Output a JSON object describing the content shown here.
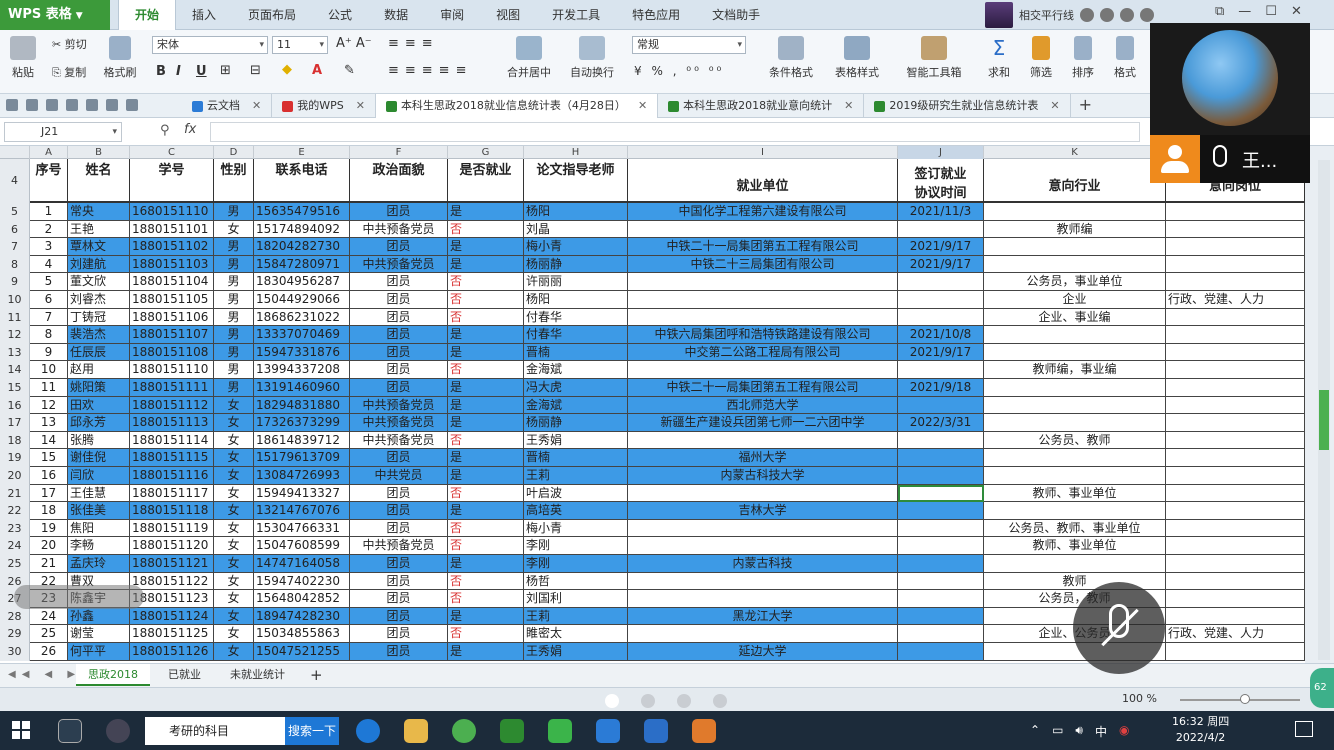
{
  "app": {
    "logo": "WPS 表格",
    "menu": [
      "开始",
      "插入",
      "页面布局",
      "公式",
      "数据",
      "审阅",
      "视图",
      "开发工具",
      "特色应用",
      "文档助手"
    ],
    "user": "相交平行线"
  },
  "ribbon": {
    "paste": "粘贴",
    "cut": "剪切",
    "copy": "复制",
    "format_painter": "格式刷",
    "font_name": "宋体",
    "font_size": "11",
    "merge_center": "合并居中",
    "wrap_text": "自动换行",
    "number_format": "常规",
    "conditional_format": "条件格式",
    "table_style": "表格样式",
    "smart_toolbox": "智能工具箱",
    "sum": "求和",
    "filter": "筛选",
    "sort": "排序",
    "format": "格式"
  },
  "doc_tabs": [
    {
      "label": "云文档",
      "color": "#2b7bd6"
    },
    {
      "label": "我的WPS",
      "color": "#d83030"
    },
    {
      "label": "本科生思政2018就业信息统计表（4月28日）",
      "color": "#2d8a30"
    },
    {
      "label": "本科生思政2018就业意向统计",
      "color": "#2d8a30"
    },
    {
      "label": "2019级研究生就业信息统计表",
      "color": "#2d8a30"
    }
  ],
  "formula_bar": {
    "cell_ref": "J21",
    "fx": "fx"
  },
  "columns": [
    "A",
    "B",
    "C",
    "D",
    "E",
    "F",
    "G",
    "H",
    "I",
    "J",
    "K",
    "L"
  ],
  "headers": {
    "a": "序号",
    "b": "姓名",
    "c": "学号",
    "d": "性别",
    "e": "联系电话",
    "f": "政治面貌",
    "g": "是否就业",
    "h": "论文指导老师",
    "i": "就业单位",
    "j1": "签订就业",
    "j2": "协议时间",
    "k": "意向行业",
    "l": "意向岗位"
  },
  "header_row_number": "4",
  "rows": [
    {
      "n": "5",
      "blue": true,
      "a": "1",
      "b": "常央",
      "c": "1680151110",
      "d": "男",
      "e": "15635479516",
      "f": "团员",
      "g": "是",
      "h": "杨阳",
      "i": "中国化学工程第六建设有限公司",
      "j": "2021/11/3",
      "k": "",
      "l": ""
    },
    {
      "n": "6",
      "blue": false,
      "a": "2",
      "b": "王艳",
      "c": "1880151101",
      "d": "女",
      "e": "15174894092",
      "f": "中共预备党员",
      "g": "否",
      "h": "刘晶",
      "i": "",
      "j": "",
      "k": "教师编",
      "l": ""
    },
    {
      "n": "7",
      "blue": true,
      "a": "3",
      "b": "覃林文",
      "c": "1880151102",
      "d": "男",
      "e": "18204282730",
      "f": "团员",
      "g": "是",
      "h": "梅小青",
      "i": "中铁二十一局集团第五工程有限公司",
      "j": "2021/9/17",
      "k": "",
      "l": ""
    },
    {
      "n": "8",
      "blue": true,
      "a": "4",
      "b": "刘建航",
      "c": "1880151103",
      "d": "男",
      "e": "15847280971",
      "f": "中共预备党员",
      "g": "是",
      "h": "杨丽静",
      "i": "中铁二十三局集团有限公司",
      "j": "2021/9/17",
      "k": "",
      "l": ""
    },
    {
      "n": "9",
      "blue": false,
      "a": "5",
      "b": "董文欣",
      "c": "1880151104",
      "d": "男",
      "e": "18304956287",
      "f": "团员",
      "g": "否",
      "h": "许丽丽",
      "i": "",
      "j": "",
      "k": "公务员，事业单位",
      "l": ""
    },
    {
      "n": "10",
      "blue": false,
      "a": "6",
      "b": "刘睿杰",
      "c": "1880151105",
      "d": "男",
      "e": "15044929066",
      "f": "团员",
      "g": "否",
      "h": "杨阳",
      "i": "",
      "j": "",
      "k": "企业",
      "l": "行政、党建、人力"
    },
    {
      "n": "11",
      "blue": false,
      "a": "7",
      "b": "丁铸冠",
      "c": "1880151106",
      "d": "男",
      "e": "18686231022",
      "f": "团员",
      "g": "否",
      "h": "付春华",
      "i": "",
      "j": "",
      "k": "企业、事业编",
      "l": ""
    },
    {
      "n": "12",
      "blue": true,
      "a": "8",
      "b": "裴浩杰",
      "c": "1880151107",
      "d": "男",
      "e": "13337070469",
      "f": "团员",
      "g": "是",
      "h": "付春华",
      "i": "中铁六局集团呼和浩特铁路建设有限公司",
      "j": "2021/10/8",
      "k": "",
      "l": ""
    },
    {
      "n": "13",
      "blue": true,
      "a": "9",
      "b": "任辰辰",
      "c": "1880151108",
      "d": "男",
      "e": "15947331876",
      "f": "团员",
      "g": "是",
      "h": "晋楠",
      "i": "中交第二公路工程局有限公司",
      "j": "2021/9/17",
      "k": "",
      "l": ""
    },
    {
      "n": "14",
      "blue": false,
      "a": "10",
      "b": "赵用",
      "c": "1880151110",
      "d": "男",
      "e": "13994337208",
      "f": "团员",
      "g": "否",
      "h": "金海斌",
      "i": "",
      "j": "",
      "k": "教师编，事业编",
      "l": ""
    },
    {
      "n": "15",
      "blue": true,
      "a": "11",
      "b": "姚阳策",
      "c": "1880151111",
      "d": "男",
      "e": "13191460960",
      "f": "团员",
      "g": "是",
      "h": "冯大虎",
      "i": "中铁二十一局集团第五工程有限公司",
      "j": "2021/9/18",
      "k": "",
      "l": ""
    },
    {
      "n": "16",
      "blue": true,
      "a": "12",
      "b": "田欢",
      "c": "1880151112",
      "d": "女",
      "e": "18294831880",
      "f": "中共预备党员",
      "g": "是",
      "h": "金海斌",
      "i": "西北师范大学",
      "j": "",
      "k": "",
      "l": ""
    },
    {
      "n": "17",
      "blue": true,
      "a": "13",
      "b": "邱永芳",
      "c": "1880151113",
      "d": "女",
      "e": "17326373299",
      "f": "中共预备党员",
      "g": "是",
      "h": "杨丽静",
      "i": "新疆生产建设兵团第七师一二六团中学",
      "j": "2022/3/31",
      "k": "",
      "l": ""
    },
    {
      "n": "18",
      "blue": false,
      "a": "14",
      "b": "张腾",
      "c": "1880151114",
      "d": "女",
      "e": "18614839712",
      "f": "中共预备党员",
      "g": "否",
      "h": "王秀娟",
      "i": "",
      "j": "",
      "k": "公务员、教师",
      "l": ""
    },
    {
      "n": "19",
      "blue": true,
      "a": "15",
      "b": "谢佳倪",
      "c": "1880151115",
      "d": "女",
      "e": "15179613709",
      "f": "团员",
      "g": "是",
      "h": "晋楠",
      "i": "福州大学",
      "j": "",
      "k": "",
      "l": ""
    },
    {
      "n": "20",
      "blue": true,
      "a": "16",
      "b": "闫欣",
      "c": "1880151116",
      "d": "女",
      "e": "13084726993",
      "f": "中共党员",
      "g": "是",
      "h": "王莉",
      "i": "内蒙古科技大学",
      "j": "",
      "k": "",
      "l": ""
    },
    {
      "n": "21",
      "blue": false,
      "a": "17",
      "b": "王佳慧",
      "c": "1880151117",
      "d": "女",
      "e": "15949413327",
      "f": "团员",
      "g": "否",
      "h": "叶启波",
      "i": "",
      "j": "",
      "k": "教师、事业单位",
      "l": "",
      "selected": true
    },
    {
      "n": "22",
      "blue": true,
      "a": "18",
      "b": "张佳美",
      "c": "1880151118",
      "d": "女",
      "e": "13214767076",
      "f": "团员",
      "g": "是",
      "h": "高培英",
      "i": "吉林大学",
      "j": "",
      "k": "",
      "l": ""
    },
    {
      "n": "23",
      "blue": false,
      "a": "19",
      "b": "焦阳",
      "c": "1880151119",
      "d": "女",
      "e": "15304766331",
      "f": "团员",
      "g": "否",
      "h": "梅小青",
      "i": "",
      "j": "",
      "k": "公务员、教师、事业单位",
      "l": ""
    },
    {
      "n": "24",
      "blue": false,
      "a": "20",
      "b": "李畅",
      "c": "1880151120",
      "d": "女",
      "e": "15047608599",
      "f": "中共预备党员",
      "g": "否",
      "h": "李刚",
      "i": "",
      "j": "",
      "k": "教师、事业单位",
      "l": ""
    },
    {
      "n": "25",
      "blue": true,
      "a": "21",
      "b": "孟庆玲",
      "c": "1880151121",
      "d": "女",
      "e": "14747164058",
      "f": "团员",
      "g": "是",
      "h": "李刚",
      "i": "内蒙古科技",
      "j": "",
      "k": "",
      "l": ""
    },
    {
      "n": "26",
      "blue": false,
      "a": "22",
      "b": "曹双",
      "c": "1880151122",
      "d": "女",
      "e": "15947402230",
      "f": "团员",
      "g": "否",
      "h": "杨哲",
      "i": "",
      "j": "",
      "k": "教师",
      "l": ""
    },
    {
      "n": "27",
      "blue": false,
      "a": "23",
      "b": "陈鑫宇",
      "c": "1880151123",
      "d": "女",
      "e": "15648042852",
      "f": "团员",
      "g": "否",
      "h": "刘国利",
      "i": "",
      "j": "",
      "k": "公务员，教师",
      "l": ""
    },
    {
      "n": "28",
      "blue": true,
      "a": "24",
      "b": "孙鑫",
      "c": "1880151124",
      "d": "女",
      "e": "18947428230",
      "f": "团员",
      "g": "是",
      "h": "王莉",
      "i": "黑龙江大学",
      "j": "",
      "k": "",
      "l": ""
    },
    {
      "n": "29",
      "blue": false,
      "a": "25",
      "b": "谢莹",
      "c": "1880151125",
      "d": "女",
      "e": "15034855863",
      "f": "团员",
      "g": "否",
      "h": "睢密太",
      "i": "",
      "j": "",
      "k": "企业、公务员",
      "l": "行政、党建、人力"
    },
    {
      "n": "30",
      "blue": true,
      "a": "26",
      "b": "何平平",
      "c": "1880151126",
      "d": "女",
      "e": "15047521255",
      "f": "团员",
      "g": "是",
      "h": "王秀娟",
      "i": "延边大学",
      "j": "",
      "k": "",
      "l": ""
    }
  ],
  "sheets": [
    "思政2018",
    "已就业",
    "未就业统计"
  ],
  "status": {
    "zoom": "100 %"
  },
  "video": {
    "name": "王..."
  },
  "taskbar": {
    "search_text": "考研的科目",
    "search_button": "搜索一下",
    "tray_ime": "中",
    "time": "16:32 周四",
    "date": "2022/4/2"
  }
}
